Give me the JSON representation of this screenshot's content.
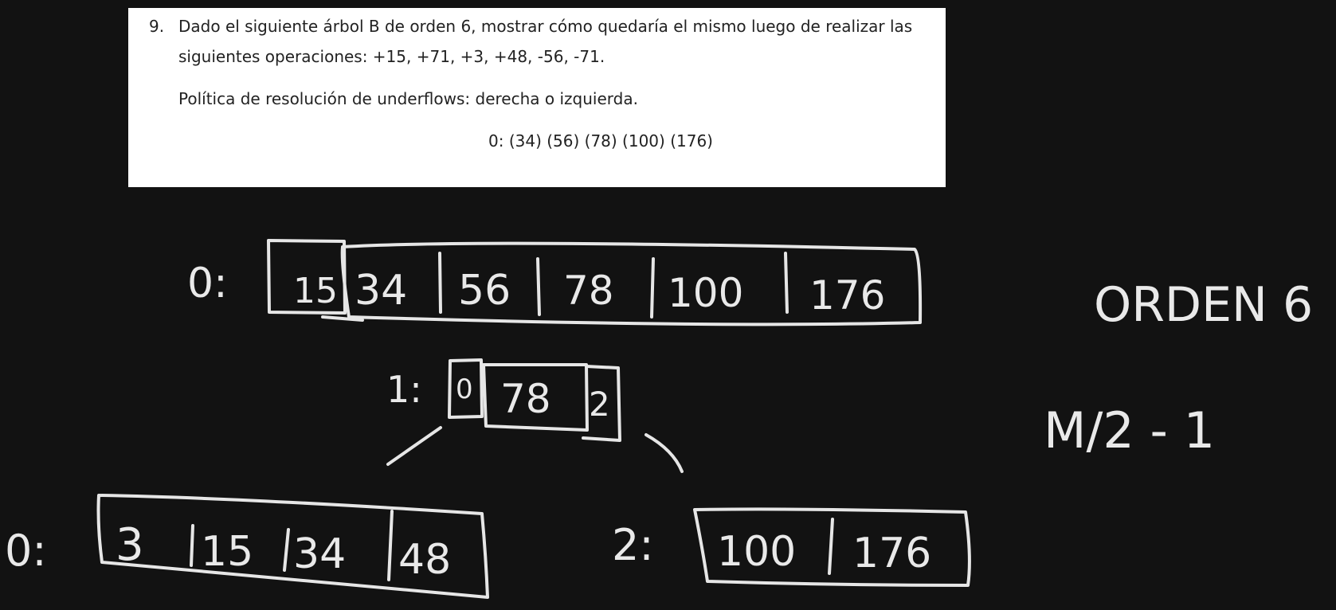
{
  "document": {
    "item_number": "9.",
    "line1": "Dado el siguiente árbol B de orden 6, mostrar cómo quedaría el mismo luego de realizar  las",
    "line2": "siguientes operaciones: +15, +71, +3, +48, -56, -71.",
    "line3": "Política de resolución de underflows: derecha o izquierda.",
    "tree": "0: (34) (56) (78) (100) (176)"
  },
  "handwriting": {
    "root_label": "0:",
    "root_keys": [
      "15",
      "34",
      "56",
      "78",
      "100",
      "176"
    ],
    "new_root_label": "1:",
    "new_root_left_ptr": "0",
    "new_root_key": "78",
    "new_root_right_ptr": "2",
    "left_leaf_label": "0:",
    "left_leaf_keys": [
      "3",
      "15",
      "34",
      "48"
    ],
    "right_leaf_label": "2:",
    "right_leaf_keys": [
      "100",
      "176"
    ],
    "note_order": "ORDEN 6",
    "note_formula": "M/2 - 1"
  }
}
